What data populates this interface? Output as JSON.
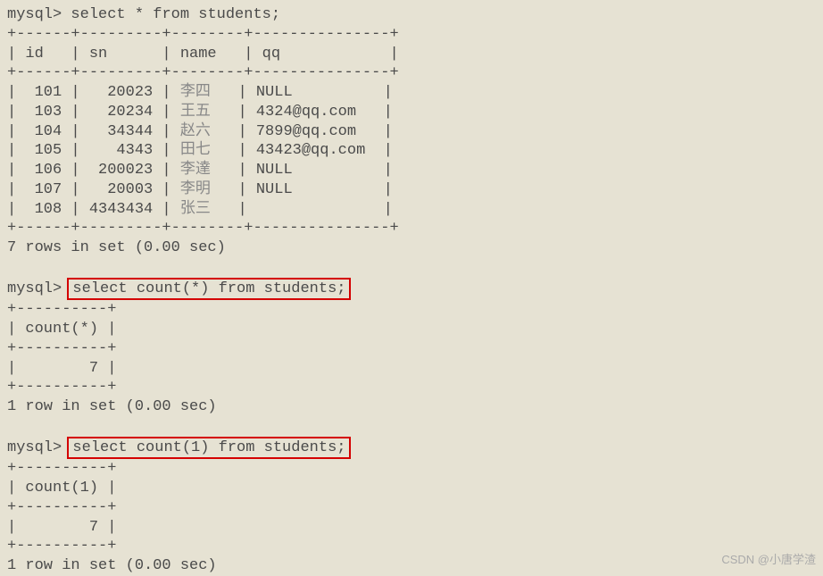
{
  "prompt": "mysql>",
  "query1": "select * from students;",
  "table1": {
    "border_top": "+------+---------+--------+---------------+",
    "header": "| id   | sn      | name   | qq            |",
    "border_mid": "+------+---------+--------+---------------+",
    "rows": [
      {
        "left": "|  101 |   20023 | ",
        "name": "李四",
        "right": "   | NULL          |"
      },
      {
        "left": "|  103 |   20234 | ",
        "name": "王五",
        "right": "   | 4324@qq.com   |"
      },
      {
        "left": "|  104 |   34344 | ",
        "name": "赵六",
        "right": "   | 7899@qq.com   |"
      },
      {
        "left": "|  105 |    4343 | ",
        "name": "田七",
        "right": "   | 43423@qq.com  |"
      },
      {
        "left": "|  106 |  200023 | ",
        "name": "李達",
        "right": "   | NULL          |"
      },
      {
        "left": "|  107 |   20003 | ",
        "name": "李明",
        "right": "   | NULL          |"
      },
      {
        "left": "|  108 | 4343434 | ",
        "name": "张三",
        "right": "   |               |"
      }
    ],
    "border_bot": "+------+---------+--------+---------------+",
    "summary": "7 rows in set (0.00 sec)"
  },
  "query2": "select count(*) from students;",
  "table2": {
    "border_top": "+----------+",
    "header": "| count(*) |",
    "border_mid": "+----------+",
    "row": "|        7 |",
    "border_bot": "+----------+",
    "summary": "1 row in set (0.00 sec)"
  },
  "query3": "select count(1) from students;",
  "table3": {
    "border_top": "+----------+",
    "header": "| count(1) |",
    "border_mid": "+----------+",
    "row": "|        7 |",
    "border_bot": "+----------+",
    "summary": "1 row in set (0.00 sec)"
  },
  "watermark": "CSDN @小唐学渣"
}
